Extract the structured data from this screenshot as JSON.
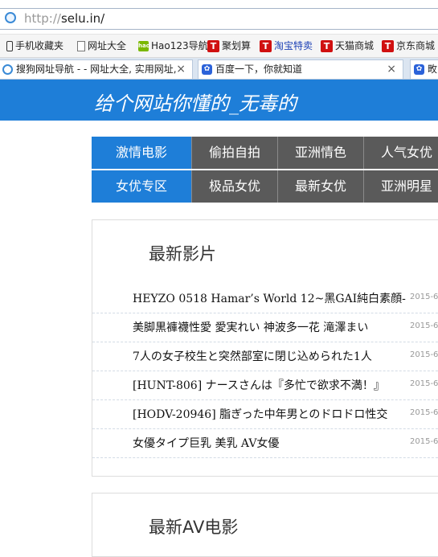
{
  "browser": {
    "url_prefix": "http://",
    "url_host": "selu.in/",
    "bookmarks": [
      {
        "label": "手机收藏夹",
        "icon": "phone-icon"
      },
      {
        "label": "网址大全",
        "icon": "document-icon"
      },
      {
        "label": "Hao123导航",
        "icon": "hao123-icon",
        "badge": "hao"
      },
      {
        "label": "聚划算",
        "icon": "tmall-t-icon",
        "badge": "T"
      },
      {
        "label": "淘宝特卖",
        "icon": "tmall-t-icon",
        "badge": "T"
      },
      {
        "label": "天猫商城",
        "icon": "tmall-t-icon",
        "badge": "T"
      },
      {
        "label": "京东商城",
        "icon": "tmall-t-icon",
        "badge": "T"
      }
    ],
    "tabs": [
      {
        "label": "搜狗网址导航 - - 网址大全, 实用网址,",
        "close": "×"
      },
      {
        "label": "百度一下，你就知道",
        "close": "×"
      },
      {
        "label": "畋",
        "close": ""
      }
    ]
  },
  "site": {
    "title": "给个网站你懂的_无毒的",
    "accent_color": "#1e7ed8",
    "nav": [
      [
        "激情电影",
        "偷拍自拍",
        "亚洲情色",
        "人气女优"
      ],
      [
        "女优专区",
        "极品女优",
        "最新女优",
        "亚洲明星"
      ]
    ]
  },
  "sections": [
    {
      "title": "最新影片",
      "items": [
        {
          "title": "HEYZO 0518 Hamar’s World 12~黑GAI純白素顔-",
          "date": "2015-6"
        },
        {
          "title": "美脚黒褲襪性愛 愛実れい 神波多一花 滝澤まい",
          "date": "2015-6"
        },
        {
          "title": "7人の女子校生と突然部室に閉じ込められた1人",
          "date": "2015-6"
        },
        {
          "title": "[HUNT-806] ナースさんは『多忙で欲求不満！』",
          "date": "2015-6"
        },
        {
          "title": "[HODV-20946] 脂ぎった中年男とのドロドロ性交",
          "date": "2015-6"
        },
        {
          "title": "女優タイプ巨乳 美乳 AV女優",
          "date": "2015-6"
        }
      ]
    },
    {
      "title": "最新AV电影",
      "items": []
    }
  ]
}
